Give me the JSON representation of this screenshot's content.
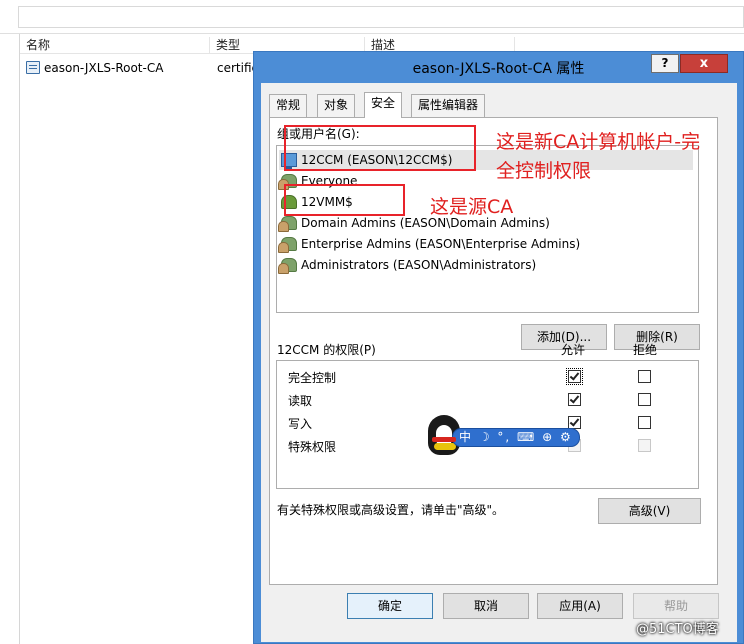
{
  "explorer": {
    "columns": [
      "名称",
      "类型",
      "描述"
    ],
    "row": {
      "name": "eason-JXLS-Root-CA",
      "type": "certific"
    }
  },
  "dialog": {
    "title": "eason-JXLS-Root-CA 属性",
    "help": "?",
    "close": "x",
    "tabs": [
      "常规",
      "对象",
      "安全",
      "属性编辑器"
    ],
    "active_tab": "安全",
    "users_label": "组或用户名(G):",
    "users": [
      {
        "label": "12CCM (EASON\\12CCM$)",
        "icon": "computer-icon",
        "selected": true
      },
      {
        "label": "Everyone",
        "icon": "group-icon"
      },
      {
        "label": "12VMM$",
        "icon": "user-icon"
      },
      {
        "label": "Domain Admins (EASON\\Domain Admins)",
        "icon": "group-icon"
      },
      {
        "label": "Enterprise Admins (EASON\\Enterprise Admins)",
        "icon": "group-icon"
      },
      {
        "label": "Administrators (EASON\\Administrators)",
        "icon": "group-icon"
      }
    ],
    "add_button": "添加(D)...",
    "remove_button": "删除(R)",
    "perm_label": "12CCM 的权限(P)",
    "allow_header": "允许",
    "deny_header": "拒绝",
    "permissions": [
      {
        "label": "完全控制",
        "allow": true,
        "deny": false
      },
      {
        "label": "读取",
        "allow": true,
        "deny": false
      },
      {
        "label": "写入",
        "allow": true,
        "deny": false
      },
      {
        "label": "特殊权限",
        "allow": false,
        "deny": false
      }
    ],
    "hint": "有关特殊权限或高级设置，请单击\"高级\"。",
    "advanced_button": "高级(V)",
    "ok_button": "确定",
    "cancel_button": "取消",
    "apply_button": "应用(A)",
    "help_button": "帮助"
  },
  "annotations": {
    "first_line1": "这是新CA计算机帐户-完",
    "first_line2": "全控制权限",
    "second": "这是源CA"
  },
  "ime": {
    "text": "中 ☽ °, ⌨ ⊕ ⚙"
  },
  "watermark": "@51CTO博客",
  "colors": {
    "annotation": "#e8232a",
    "dialog_frame": "#4c8dd6",
    "close_button": "#c7403a"
  }
}
